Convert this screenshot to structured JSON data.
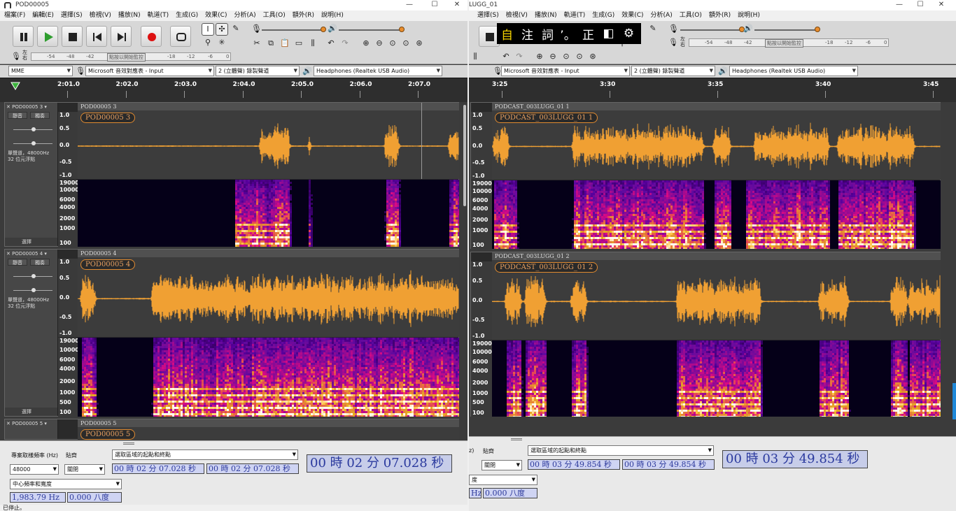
{
  "left": {
    "title": "POD00005",
    "menu": [
      "檔案(F)",
      "編輯(E)",
      "選擇(S)",
      "檢視(V)",
      "播放(N)",
      "軌道(T)",
      "生成(G)",
      "效果(C)",
      "分析(A)",
      "工具(O)",
      "額外(R)",
      "說明(H)"
    ],
    "meter_label_lr": "左\n右",
    "meter_ticks": [
      "-54",
      "-48",
      "-42",
      "點按以開始監控",
      "-18",
      "-12",
      "-6",
      "0"
    ],
    "devices": {
      "host": "MME",
      "input": "Microsoft 音效對應表 - Input",
      "channels": "2 (立體聲) 錄製聲道",
      "output": "Headphones (Realtek USB Audio)"
    },
    "timeline": [
      "2:01.0",
      "2:02.0",
      "2:03.0",
      "2:04.0",
      "2:05.0",
      "2:06.0",
      "2:07.0"
    ],
    "tracks": [
      {
        "name": "POD00005 3",
        "clip": "POD00005 3",
        "mute": "靜音",
        "solo": "獨奏",
        "info": "單聲道，48000Hz\n32 位元浮點",
        "select": "選擇"
      },
      {
        "name": "POD00005 4",
        "clip": "POD00005 4",
        "mute": "靜音",
        "solo": "獨奏",
        "info": "單聲道，48000Hz\n32 位元浮點",
        "select": "選擇"
      },
      {
        "name": "POD00005 5",
        "clip": "POD00005 5"
      }
    ],
    "amp_ticks": [
      "1.0",
      "0.5",
      "0.0",
      "-0.5",
      "-1.0"
    ],
    "freq_ticks": [
      "19000",
      "10000",
      "6000",
      "4000",
      "2000",
      "1000",
      "100"
    ],
    "freq_ticks2": [
      "19000",
      "10000",
      "6000",
      "4000",
      "2000",
      "1000",
      "500",
      "100"
    ],
    "rate_label": "專案取樣頻率 (Hz)",
    "rate_value": "48000",
    "snap_label": "貼齊",
    "snap_value": "關閉",
    "sel_mode": "選取區域的起點和終點",
    "sel_start": "00 時 02 分 07.028 秒",
    "sel_end": "00 時 02 分 07.028 秒",
    "position": "00 時 02 分 07.028 秒",
    "spec_mode": "中心頻率和寬度",
    "center_freq": "1,983.79 Hz",
    "width": "0.000 八度",
    "status": "已停止。"
  },
  "right": {
    "title": "LUGG_01",
    "menu": [
      "選擇(S)",
      "檢視(V)",
      "播放(N)",
      "軌道(T)",
      "生成(G)",
      "效果(C)",
      "分析(A)",
      "工具(O)",
      "額外(R)",
      "說明(H)"
    ],
    "devices": {
      "input": "Microsoft 音效對應表 - Input",
      "channels": "2 (立體聲) 錄製聲道",
      "output": "Headphones (Realtek USB Audio)"
    },
    "timeline": [
      "3:25",
      "3:30",
      "3:35",
      "3:40",
      "3:45"
    ],
    "tracks": [
      {
        "name": "PODCAST_003LUGG_01 1",
        "clip": "PODCAST_003LUGG_01 1"
      },
      {
        "name": "PODCAST_003LUGG_01 2",
        "clip": "PODCAST_003LUGG_01 2"
      }
    ],
    "freq_ticks": [
      "19000",
      "10000",
      "6000",
      "4000",
      "2000",
      "1000",
      "100"
    ],
    "freq_ticks2": [
      "19000",
      "10000",
      "6000",
      "4000",
      "2000",
      "1000",
      "500",
      "100"
    ],
    "rate_label": "z)",
    "snap_label": "貼齊",
    "snap_value": "關閉",
    "sel_mode": "選取區域的起點和終點",
    "sel_start": "00 時 03 分 49.854 秒",
    "sel_end": "00 時 03 分 49.854 秒",
    "position": "00 時 03 分 49.854 秒",
    "spec_mode": "度",
    "center_freq": "Hz",
    "width": "0.000 八度"
  },
  "ime": [
    "自",
    "注",
    "詞",
    "’。",
    "正",
    "◧",
    "⚙"
  ],
  "colors": {
    "wave": "#f0a033",
    "bg": "#3b3b3b"
  }
}
